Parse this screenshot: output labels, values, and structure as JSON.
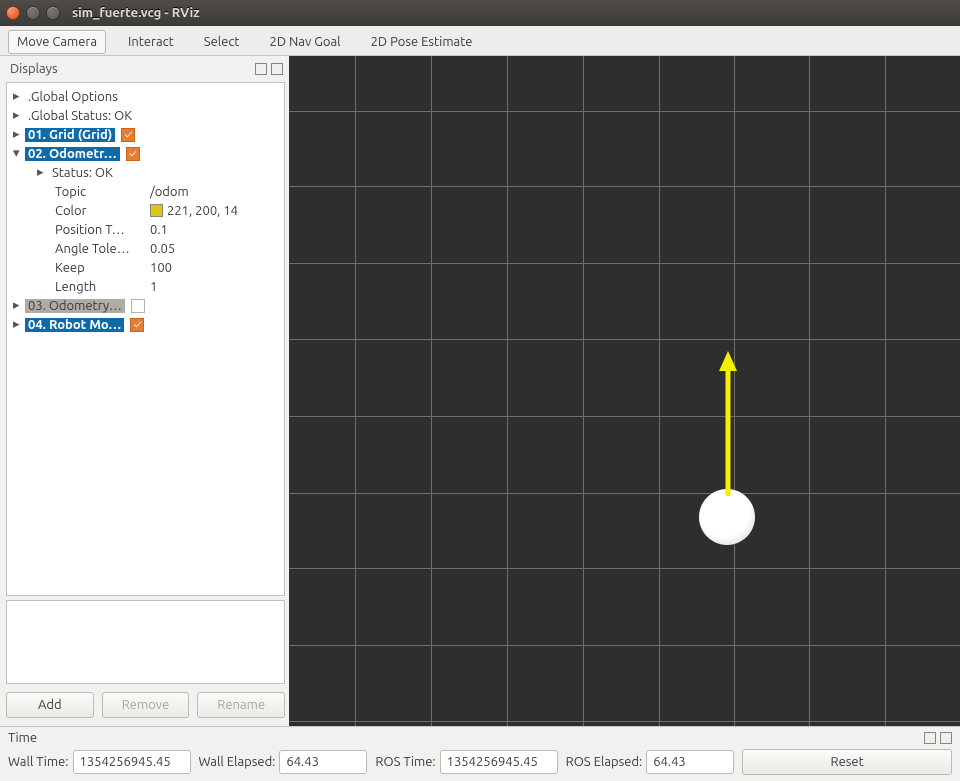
{
  "window": {
    "title": "sim_fuerte.vcg - RViz"
  },
  "toolbar": {
    "items": [
      "Move Camera",
      "Interact",
      "Select",
      "2D Nav Goal",
      "2D Pose Estimate"
    ],
    "selected": 0
  },
  "displays": {
    "title": "Displays",
    "tree": {
      "global_options": ".Global Options",
      "global_status": ".Global Status: OK",
      "item_grid": {
        "label": "01. Grid (Grid)",
        "checked": true,
        "selected": true
      },
      "item_odom": {
        "label": "02. Odometr…",
        "checked": true,
        "selected": true,
        "expanded": true,
        "status": "Status: OK",
        "props": {
          "topic": {
            "name": "Topic",
            "value": "/odom"
          },
          "color": {
            "name": "Color",
            "value": "221, 200, 14",
            "swatch": "#ddc80e"
          },
          "position_tol": {
            "name": "Position T…",
            "value": "0.1"
          },
          "angle_tol": {
            "name": "Angle Tole…",
            "value": "0.05"
          },
          "keep": {
            "name": "Keep",
            "value": "100"
          },
          "length": {
            "name": "Length",
            "value": "1"
          }
        }
      },
      "item_odom2": {
        "label": "03. Odometry…",
        "checked": false,
        "grey": true
      },
      "item_robot": {
        "label": "04. Robot Mo…",
        "checked": true,
        "selected": true
      }
    },
    "buttons": {
      "add": "Add",
      "remove": "Remove",
      "rename": "Rename"
    }
  },
  "timebar": {
    "title": "Time",
    "wall_time_label": "Wall Time:",
    "wall_time_value": "1354256945.45",
    "wall_elapsed_label": "Wall Elapsed:",
    "wall_elapsed_value": "64.43",
    "ros_time_label": "ROS Time:",
    "ros_time_value": "1354256945.45",
    "ros_elapsed_label": "ROS Elapsed:",
    "ros_elapsed_value": "64.43",
    "reset_label": "Reset"
  },
  "scene": {
    "grid_rows": [
      -20,
      55,
      130,
      207,
      283,
      360,
      437,
      512,
      589,
      665
    ],
    "grid_cols": [
      -8,
      66,
      142,
      218,
      294,
      370,
      445,
      520,
      596,
      672
    ],
    "arrow_color": "#f7ef00"
  }
}
